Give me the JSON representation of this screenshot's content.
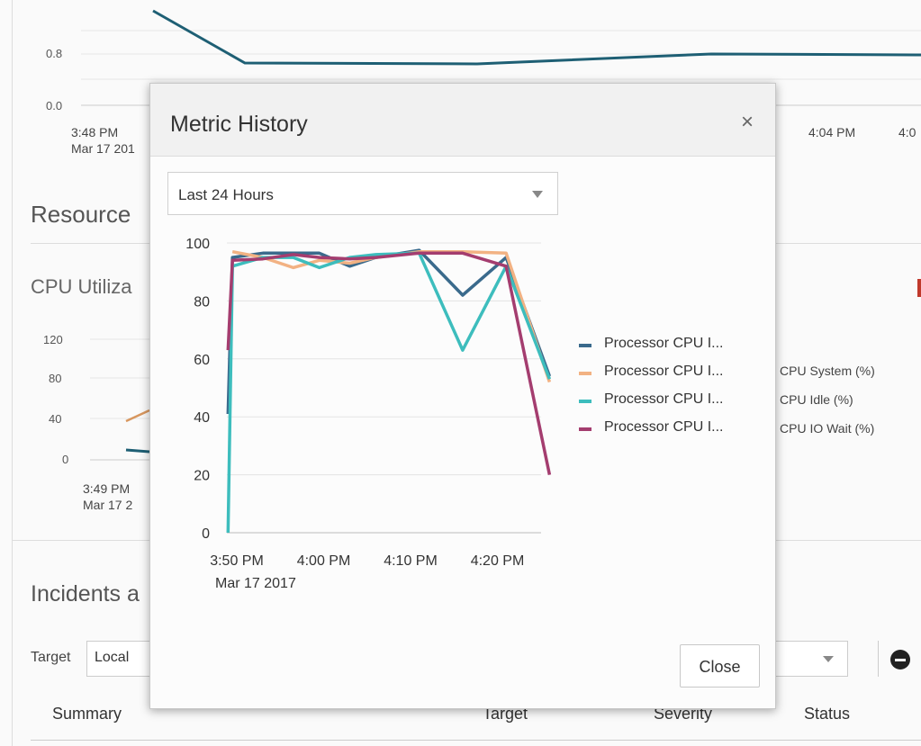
{
  "background": {
    "top_chart": {
      "y_ticks": [
        "0.8",
        "0.0"
      ],
      "x_labels": [
        {
          "time": "3:48 PM",
          "date": "Mar 17 201"
        },
        {
          "time": "4:04 PM",
          "date": ""
        },
        {
          "time": "4:0",
          "date": ""
        }
      ]
    },
    "section_title": "Resource",
    "cpu_title": "CPU Utiliza",
    "cpu_chart": {
      "y_ticks": [
        "120",
        "80",
        "40",
        "0"
      ],
      "x_label": {
        "time": "3:49 PM",
        "date": "Mar 17 2"
      },
      "legend": [
        "CPU System (%)",
        "CPU Idle (%)",
        "CPU IO Wait (%)"
      ],
      "series_colors": [
        "#d8975f",
        "#1e5f74"
      ]
    },
    "incidents_title": "Incidents a",
    "target_label": "Target",
    "target_value": "Local",
    "columns": [
      "Summary",
      "Target",
      "Severity",
      "Status"
    ]
  },
  "dialog": {
    "title": "Metric History",
    "close_icon": "close-icon",
    "range": {
      "selected": "Last 24 Hours"
    },
    "close_label": "Close",
    "legend": [
      {
        "label": "Processor CPU I...",
        "color": "#3a6a8c"
      },
      {
        "label": "Processor CPU I...",
        "color": "#f2b283"
      },
      {
        "label": "Processor CPU I...",
        "color": "#3dbdbd"
      },
      {
        "label": "Processor CPU I...",
        "color": "#a43d6f"
      }
    ]
  },
  "chart_data": {
    "type": "line",
    "title": "",
    "ylim": [
      0,
      100
    ],
    "y_ticks": [
      "0",
      "20",
      "40",
      "60",
      "80",
      "100"
    ],
    "x_tick_labels": [
      {
        "label": "3:50 PM",
        "sub": "Mar 17 2017",
        "minute": 0
      },
      {
        "label": "4:00 PM",
        "sub": "",
        "minute": 10
      },
      {
        "label": "4:10 PM",
        "sub": "",
        "minute": 20
      },
      {
        "label": "4:20 PM",
        "sub": "",
        "minute": 30
      }
    ],
    "x_minutes": [
      -1,
      -0.5,
      3,
      6.5,
      9.5,
      13,
      16,
      21,
      26,
      31,
      36
    ],
    "series": [
      {
        "color": "#3a6a8c",
        "values": [
          41,
          95,
          96.5,
          96.5,
          96.5,
          92,
          95,
          97.5,
          82,
          95,
          54
        ]
      },
      {
        "color": "#f2b283",
        "values": [
          null,
          97,
          95,
          91.5,
          94,
          93,
          95,
          97,
          97,
          96.5,
          52
        ]
      },
      {
        "color": "#3dbdbd",
        "values": [
          0,
          92,
          95,
          95,
          91.5,
          95,
          96,
          96.5,
          63,
          92,
          53
        ]
      },
      {
        "color": "#a43d6f",
        "values": [
          63,
          94,
          94.5,
          96,
          95,
          94.5,
          95,
          96.5,
          96.5,
          92,
          20
        ]
      }
    ]
  }
}
